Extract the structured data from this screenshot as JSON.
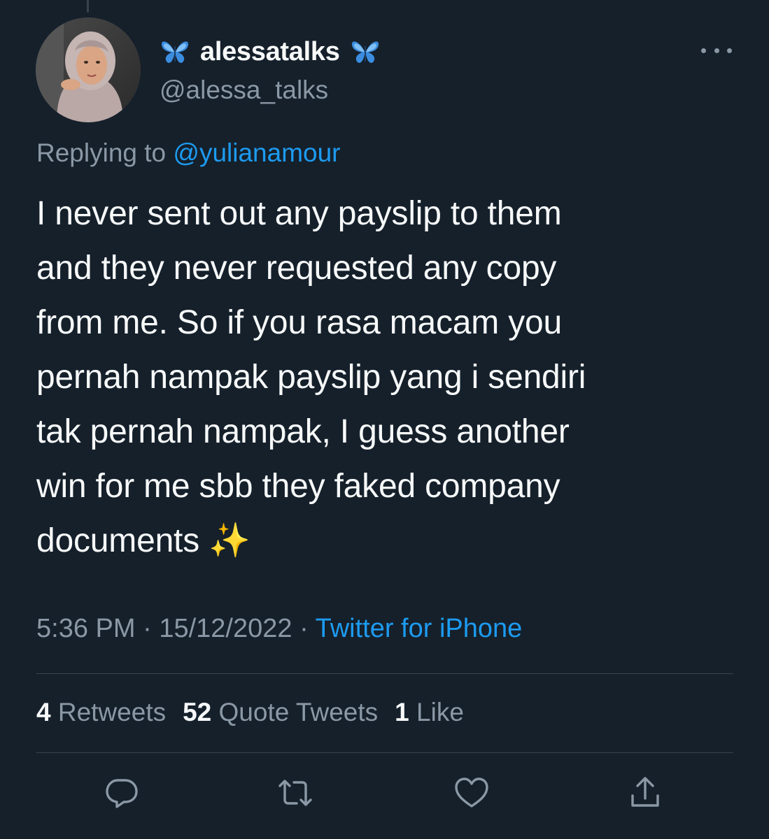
{
  "tweet": {
    "display_name": "alessatalks",
    "handle": "@alessa_talks",
    "name_emoji": "butterfly",
    "replying_prefix": "Replying to",
    "replying_to": "@yulianamour",
    "text_lines": [
      "I never sent out any payslip to them",
      "and they never requested any copy",
      "from me. So if you rasa macam you",
      "pernah nampak payslip yang i sendiri",
      "tak pernah nampak, I guess another",
      "win for me sbb they faked company",
      "documents ✨"
    ],
    "time": "5:36 PM",
    "separator": "·",
    "date": "15/12/2022",
    "source": "Twitter for iPhone"
  },
  "stats": {
    "retweets_count": "4",
    "retweets_label": "Retweets",
    "quotes_count": "52",
    "quotes_label": "Quote Tweets",
    "likes_count": "1",
    "likes_label": "Like"
  },
  "icons": {
    "more": "more-horizontal-icon",
    "reply": "reply-icon",
    "retweet": "retweet-icon",
    "like": "heart-icon",
    "share": "share-icon"
  },
  "colors": {
    "background": "#15202b",
    "text": "#f7f9f9",
    "secondary": "#8b98a5",
    "accent": "#1d9bf0",
    "divider": "#38444d",
    "butterfly": "#3b8de0"
  }
}
